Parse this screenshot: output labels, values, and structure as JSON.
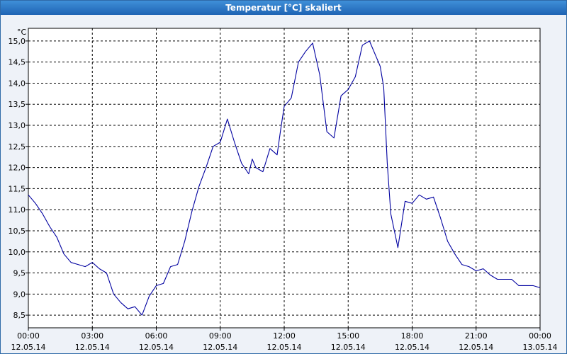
{
  "window": {
    "title": "Temperatur [°C] skaliert"
  },
  "chart_data": {
    "type": "line",
    "title": "Temperatur [°C] skaliert",
    "ylabel": "°C",
    "xlabel": "",
    "grid": true,
    "ylim": [
      8.2,
      15.3
    ],
    "xlim": [
      "2014-05-12 00:00",
      "2014-05-13 00:00"
    ],
    "y_ticks": [
      "15,0",
      "14,5",
      "14,0",
      "13,5",
      "13,0",
      "12,5",
      "12,0",
      "11,5",
      "11,0",
      "10,5",
      "10,0",
      "9,5",
      "9,0",
      "8,5"
    ],
    "x_ticks": [
      {
        "time": "00:00",
        "date": "12.05.14"
      },
      {
        "time": "03:00",
        "date": "12.05.14"
      },
      {
        "time": "06:00",
        "date": "12.05.14"
      },
      {
        "time": "09:00",
        "date": "12.05.14"
      },
      {
        "time": "12:00",
        "date": "12.05.14"
      },
      {
        "time": "15:00",
        "date": "12.05.14"
      },
      {
        "time": "18:00",
        "date": "12.05.14"
      },
      {
        "time": "21:00",
        "date": "12.05.14"
      },
      {
        "time": "00:00",
        "date": "13.05.14"
      }
    ],
    "series": [
      {
        "color": "#0000a0",
        "x": [
          "00:00",
          "00:20",
          "00:40",
          "01:00",
          "01:20",
          "01:40",
          "02:00",
          "02:20",
          "02:40",
          "03:00",
          "03:20",
          "03:40",
          "04:00",
          "04:20",
          "04:40",
          "05:00",
          "05:20",
          "05:40",
          "06:00",
          "06:20",
          "06:40",
          "07:00",
          "07:20",
          "07:40",
          "08:00",
          "08:20",
          "08:40",
          "09:00",
          "09:20",
          "09:40",
          "10:00",
          "10:20",
          "10:30",
          "10:40",
          "11:00",
          "11:20",
          "11:40",
          "11:50",
          "12:00",
          "12:20",
          "12:40",
          "13:00",
          "13:20",
          "13:40",
          "14:00",
          "14:20",
          "14:40",
          "15:00",
          "15:20",
          "15:40",
          "16:00",
          "16:20",
          "16:30",
          "16:40",
          "16:50",
          "17:00",
          "17:20",
          "17:40",
          "18:00",
          "18:20",
          "18:40",
          "19:00",
          "19:20",
          "19:40",
          "20:00",
          "20:20",
          "20:40",
          "21:00",
          "21:20",
          "21:40",
          "22:00",
          "22:20",
          "22:40",
          "23:00",
          "23:20",
          "23:40",
          "24:00"
        ],
        "y": [
          11.35,
          11.15,
          10.9,
          10.6,
          10.35,
          9.95,
          9.75,
          9.7,
          9.65,
          9.75,
          9.6,
          9.5,
          9.0,
          8.8,
          8.65,
          8.7,
          8.5,
          8.95,
          9.2,
          9.25,
          9.65,
          9.7,
          10.25,
          10.95,
          11.55,
          12.0,
          12.5,
          12.6,
          13.15,
          12.6,
          12.1,
          11.85,
          12.2,
          12.0,
          11.9,
          12.45,
          12.3,
          12.9,
          13.45,
          13.65,
          14.5,
          14.75,
          14.95,
          14.2,
          12.85,
          12.7,
          13.7,
          13.85,
          14.15,
          14.9,
          15.0,
          14.6,
          14.4,
          13.9,
          12.1,
          10.9,
          10.1,
          11.2,
          11.15,
          11.35,
          11.25,
          11.3,
          10.8,
          10.25,
          9.95,
          9.7,
          9.65,
          9.55,
          9.6,
          9.45,
          9.35,
          9.35,
          9.35,
          9.2,
          9.2,
          9.2,
          9.15
        ]
      }
    ]
  }
}
